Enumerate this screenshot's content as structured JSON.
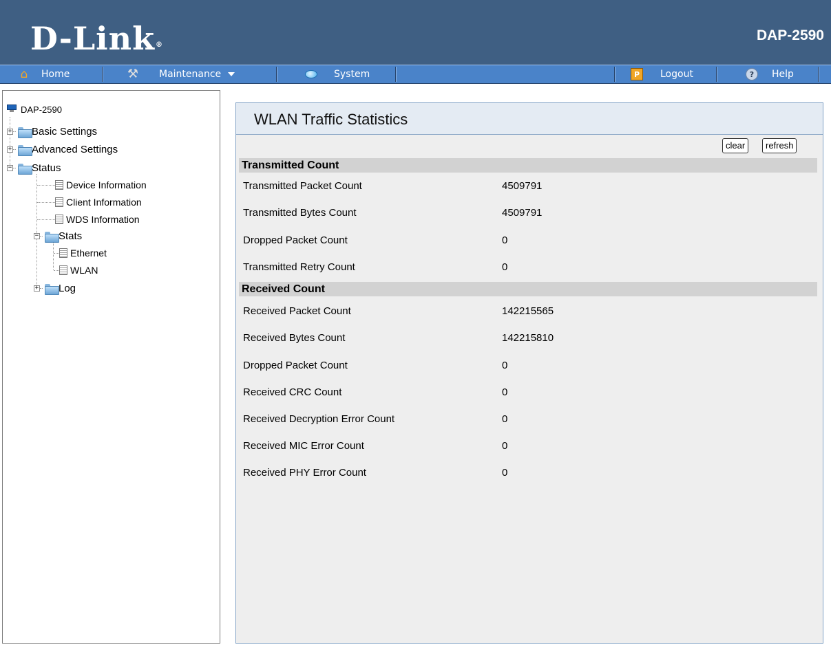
{
  "header": {
    "brand": "D-Link",
    "model": "DAP-2590"
  },
  "menu": {
    "home": "Home",
    "maintenance": "Maintenance",
    "system": "System",
    "logout": "Logout",
    "help": "Help"
  },
  "tree": {
    "root": "DAP-2590",
    "basic": "Basic Settings",
    "advanced": "Advanced Settings",
    "status": "Status",
    "device_info": "Device Information",
    "client_info": "Client Information",
    "wds_info": "WDS Information",
    "stats": "Stats",
    "ethernet": "Ethernet",
    "wlan": "WLAN",
    "log": "Log"
  },
  "page": {
    "title": "WLAN Traffic Statistics",
    "clear_label": "clear",
    "refresh_label": "refresh"
  },
  "transmitted": {
    "heading": "Transmitted Count",
    "rows": [
      {
        "label": "Transmitted Packet Count",
        "value": "4509791"
      },
      {
        "label": "Transmitted Bytes Count",
        "value": "4509791"
      },
      {
        "label": "Dropped Packet Count",
        "value": "0"
      },
      {
        "label": "Transmitted Retry Count",
        "value": "0"
      }
    ]
  },
  "received": {
    "heading": "Received Count",
    "rows": [
      {
        "label": "Received Packet Count",
        "value": "142215565"
      },
      {
        "label": "Received Bytes Count",
        "value": "142215810"
      },
      {
        "label": "Dropped Packet Count",
        "value": "0"
      },
      {
        "label": "Received CRC Count",
        "value": "0"
      },
      {
        "label": "Received Decryption Error Count",
        "value": "0"
      },
      {
        "label": "Received MIC Error Count",
        "value": "0"
      },
      {
        "label": "Received PHY Error Count",
        "value": "0"
      }
    ]
  },
  "colors": {
    "header_bg": "#3f5f83",
    "menubar_bg": "#4a83c9",
    "section_bg": "#d2d2d2",
    "panel_bg": "#eeeeee"
  },
  "icons": {
    "home": "home-icon",
    "maintenance": "tools-icon",
    "system": "system-icon",
    "logout": "key-icon",
    "help": "help-icon"
  }
}
